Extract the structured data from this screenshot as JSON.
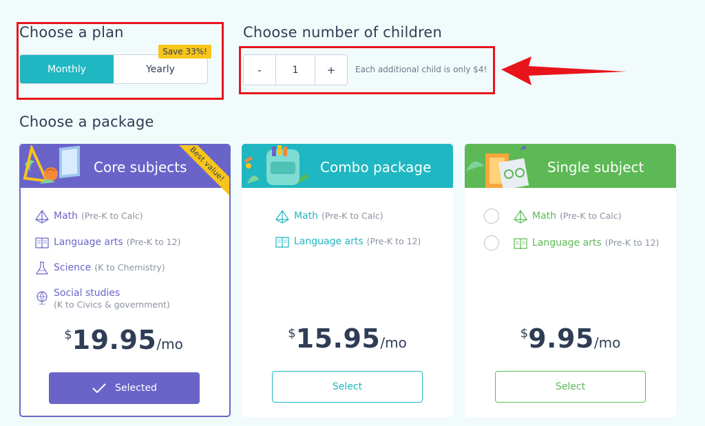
{
  "plan": {
    "heading": "Choose a plan",
    "options": [
      {
        "label": "Monthly",
        "active": true
      },
      {
        "label": "Yearly",
        "active": false
      }
    ],
    "save_badge": "Save 33%!"
  },
  "children": {
    "heading": "Choose number of children",
    "decrement": "-",
    "value": "1",
    "increment": "+",
    "hint": "Each additional child is only $4!"
  },
  "packages": {
    "heading": "Choose a package",
    "cards": [
      {
        "title": "Core subjects",
        "badge": "Best value!",
        "color": "#6a64c9",
        "subjects": [
          {
            "name": "Math",
            "range": "(Pre-K to Calc)",
            "icon": "pyramid-icon"
          },
          {
            "name": "Language arts",
            "range": "(Pre-K to 12)",
            "icon": "book-icon"
          },
          {
            "name": "Science",
            "range": "(K to Chemistry)",
            "icon": "flask-icon"
          },
          {
            "name": "Social studies",
            "range": "(K to Civics & government)",
            "icon": "globe-icon"
          }
        ],
        "currency": "$",
        "price": "19.95",
        "period": "/mo",
        "button": "Selected",
        "selected": true
      },
      {
        "title": "Combo package",
        "color": "#1fb7c1",
        "subjects": [
          {
            "name": "Math",
            "range": "(Pre-K to Calc)",
            "icon": "pyramid-icon"
          },
          {
            "name": "Language arts",
            "range": "(Pre-K to 12)",
            "icon": "book-icon"
          }
        ],
        "currency": "$",
        "price": "15.95",
        "period": "/mo",
        "button": "Select",
        "selected": false
      },
      {
        "title": "Single subject",
        "color": "#5cb955",
        "subjects": [
          {
            "name": "Math",
            "range": "(Pre-K to Calc)",
            "icon": "pyramid-icon"
          },
          {
            "name": "Language arts",
            "range": "(Pre-K to 12)",
            "icon": "book-icon"
          }
        ],
        "currency": "$",
        "price": "9.95",
        "period": "/mo",
        "button": "Select",
        "selected": false
      }
    ]
  },
  "colors": {
    "accent_red": "#e8141c",
    "teal": "#1fb7c1",
    "purple": "#6a64c9",
    "green": "#5cb955",
    "yellow": "#f7c51b"
  }
}
